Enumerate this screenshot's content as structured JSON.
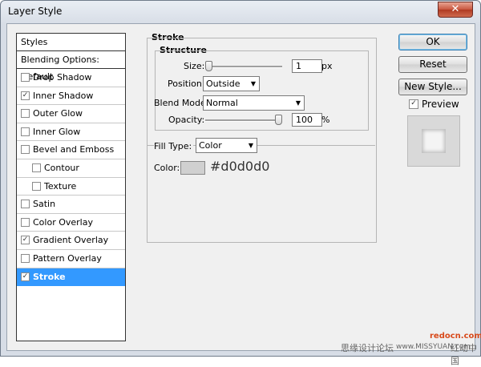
{
  "window": {
    "title": "Layer Style",
    "close_glyph": "✕"
  },
  "styles_panel": {
    "header": "Styles",
    "blending_options": "Blending Options: Default",
    "items": [
      {
        "label": "Drop Shadow",
        "checked": false,
        "indent": false,
        "selected": false
      },
      {
        "label": "Inner Shadow",
        "checked": true,
        "indent": false,
        "selected": false
      },
      {
        "label": "Outer Glow",
        "checked": false,
        "indent": false,
        "selected": false
      },
      {
        "label": "Inner Glow",
        "checked": false,
        "indent": false,
        "selected": false
      },
      {
        "label": "Bevel and Emboss",
        "checked": false,
        "indent": false,
        "selected": false
      },
      {
        "label": "Contour",
        "checked": false,
        "indent": true,
        "selected": false
      },
      {
        "label": "Texture",
        "checked": false,
        "indent": true,
        "selected": false
      },
      {
        "label": "Satin",
        "checked": false,
        "indent": false,
        "selected": false
      },
      {
        "label": "Color Overlay",
        "checked": false,
        "indent": false,
        "selected": false
      },
      {
        "label": "Gradient Overlay",
        "checked": true,
        "indent": false,
        "selected": false
      },
      {
        "label": "Pattern Overlay",
        "checked": false,
        "indent": false,
        "selected": false
      },
      {
        "label": "Stroke",
        "checked": true,
        "indent": false,
        "selected": true
      }
    ]
  },
  "stroke": {
    "title": "Stroke",
    "structure_title": "Structure",
    "size_label": "Size:",
    "size_value": "1",
    "size_unit": "px",
    "size_level": 0.0,
    "position_label": "Position:",
    "position_value": "Outside",
    "blend_mode_label": "Blend Mode:",
    "blend_mode_value": "Normal",
    "opacity_label": "Opacity:",
    "opacity_value": "100",
    "opacity_unit": "%",
    "opacity_level": 1.0,
    "fill_type_label": "Fill Type:",
    "fill_type_value": "Color",
    "color_label": "Color:",
    "color_hex": "#d0d0d0",
    "color_text": "#d0d0d0"
  },
  "buttons": {
    "ok": "OK",
    "reset": "Reset",
    "new_style": "New Style...",
    "preview_label": "Preview",
    "preview_checked": true
  },
  "watermarks": {
    "top": "redocn.com",
    "bottom_left": "思缘设计论坛",
    "bottom_url": "www.MISSYUAN.com",
    "bottom_right": "红动中国"
  },
  "icons": {
    "checkmark": "✓",
    "dropdown_arrow": "▼"
  }
}
